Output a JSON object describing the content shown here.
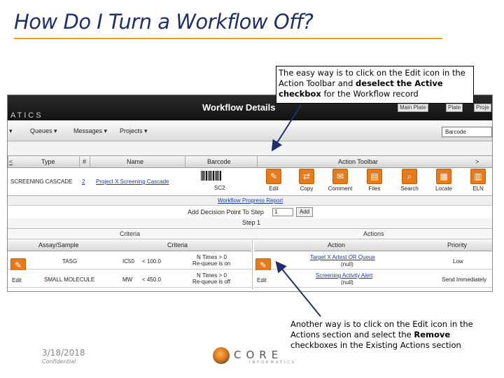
{
  "slide": {
    "title": "How Do I Turn a Workflow Off?",
    "date": "3/18/2018",
    "confidential": "Confidential",
    "logo_text": "CORE",
    "logo_sub": "INFORMATICS"
  },
  "callouts": {
    "top": {
      "before": "The easy way is to click on the Edit icon in the Action Toolbar and ",
      "bold1": "deselect the Active checkbox",
      "after": " for the Workflow record"
    },
    "bottom": {
      "before": "Another way is to click on the Edit icon in the Actions section and select the ",
      "bold1": "Remove",
      "after": " checkboxes in the Existing Actions section"
    }
  },
  "app": {
    "name_fragment": "ATICS",
    "page_title": "Workflow Details",
    "header_buttons": [
      "Main Plate",
      "Plate",
      "Proje"
    ],
    "menus": [
      "Queues ▾",
      "Messages ▾",
      "Projects ▾"
    ],
    "menu_arrow": "▾",
    "search_select": "Barcode"
  },
  "workflow_table": {
    "headers": {
      "type": "Type",
      "num": "#",
      "name": "Name",
      "barcode": "Barcode",
      "toolbar": "Action Toolbar",
      "left_nav": "<",
      "right_nav": ">"
    },
    "row": {
      "type": "SCREENING CASCADE",
      "num": "2",
      "name": "Project X Screening Cascade",
      "barcode": "SC2"
    },
    "toolbar_buttons": [
      {
        "label": "Edit",
        "icon": "edit-icon",
        "glyph": "✎"
      },
      {
        "label": "Copy",
        "icon": "copy-icon",
        "glyph": "⇄"
      },
      {
        "label": "Comment",
        "icon": "comment-icon",
        "glyph": "✉"
      },
      {
        "label": "Files",
        "icon": "files-icon",
        "glyph": "▤"
      },
      {
        "label": "Search",
        "icon": "search-icon",
        "glyph": "⌕"
      },
      {
        "label": "Locate",
        "icon": "locate-icon",
        "glyph": "▦"
      },
      {
        "label": "ELN",
        "icon": "eln-icon",
        "glyph": "▥"
      }
    ]
  },
  "progress": {
    "link": "Workflow Progress Report",
    "decision_label": "Add Decision Point To Step",
    "decision_value": "1",
    "add_label": "Add",
    "step_label": "Step 1"
  },
  "sections": {
    "criteria_title": "Criteria",
    "actions_title": "Actions",
    "criteria_headers": [
      "Assay/Sample",
      "Criteria"
    ],
    "action_headers": [
      "Action",
      "Priority"
    ],
    "edit_label": "Edit",
    "criteria_rows": [
      {
        "assay": "TASG",
        "metric": "IC50",
        "cond": "< 100.0",
        "times": "N Times > 0",
        "requeue": "Re-queue is on"
      },
      {
        "assay": "SMALL MOLECULE",
        "metric": "MW",
        "cond": "< 450.0",
        "times": "N Times > 0",
        "requeue": "Re-queue is off"
      }
    ],
    "action_rows": [
      {
        "action": "Target X Artest OR Queue",
        "sub": "(null)",
        "priority": "Low"
      },
      {
        "action": "Screening Activity Alert",
        "sub": "(null)",
        "priority": "Send Immediately"
      }
    ]
  },
  "colors": {
    "title": "#1f2f6e",
    "rule": "#f0a000",
    "icon": "#e77b1c"
  }
}
